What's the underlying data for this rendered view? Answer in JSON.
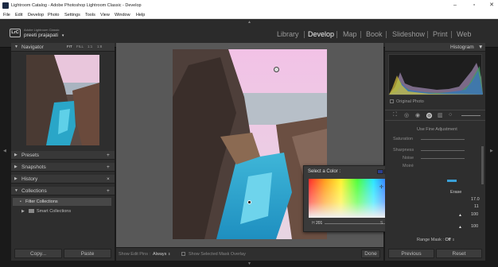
{
  "window": {
    "title": "Lightroom Catalog - Adobe Photoshop Lightroom Classic - Develop",
    "minimize": "–",
    "maximize": "▫",
    "close": "✕"
  },
  "menu": [
    "File",
    "Edit",
    "Develop",
    "Photo",
    "Settings",
    "Tools",
    "View",
    "Window",
    "Help"
  ],
  "identity": {
    "badge": "LrC",
    "subtitle": "Adobe Lightroom Classic",
    "user": "preeti prajapati",
    "user_caret": "▾"
  },
  "modules": [
    "Library",
    "Develop",
    "Map",
    "Book",
    "Slideshow",
    "Print",
    "Web"
  ],
  "active_module": "Develop",
  "left_panel": {
    "navigator": {
      "label": "Navigator",
      "zoom_options": [
        "FIT",
        "FILL",
        "1:1",
        "1:8"
      ]
    },
    "sections": [
      {
        "label": "Presets",
        "action": "+"
      },
      {
        "label": "Snapshots",
        "action": "+"
      },
      {
        "label": "History",
        "action": "×"
      },
      {
        "label": "Collections",
        "action": "+"
      }
    ],
    "collections_items": [
      "Filter Collections",
      "Smart Collections"
    ],
    "copy_label": "Copy...",
    "paste_label": "Paste"
  },
  "toolbar": {
    "show_edit_pins_label": "Show Edit Pins :",
    "show_edit_pins_value": "Always",
    "show_mask_label": "Show Selected Mask Overlay",
    "done_label": "Done"
  },
  "right_panel": {
    "histogram_label": "Histogram",
    "original_photo": "Original Photo",
    "use_fine_adjustment": "Use Fine Adjustment",
    "sliders": [
      "Saturation",
      "Sharpness",
      "Noise",
      "Moiré"
    ],
    "erase_label": "Erase",
    "values": [
      "17.0",
      "11",
      "100",
      "100"
    ],
    "range_mask_label": "Range Mask :",
    "range_mask_value": "Off",
    "previous_label": "Previous",
    "reset_label": "Reset"
  },
  "color_picker": {
    "label": "Select a Color :",
    "h_value": "201",
    "s_value": "80",
    "unit": "%",
    "swatches": [
      "#2c3f8e",
      "#3a58b8",
      "#c9b33a",
      "#d6c24a",
      "#b5a24e",
      "#d8d8d8",
      "#3aa0d8"
    ]
  }
}
